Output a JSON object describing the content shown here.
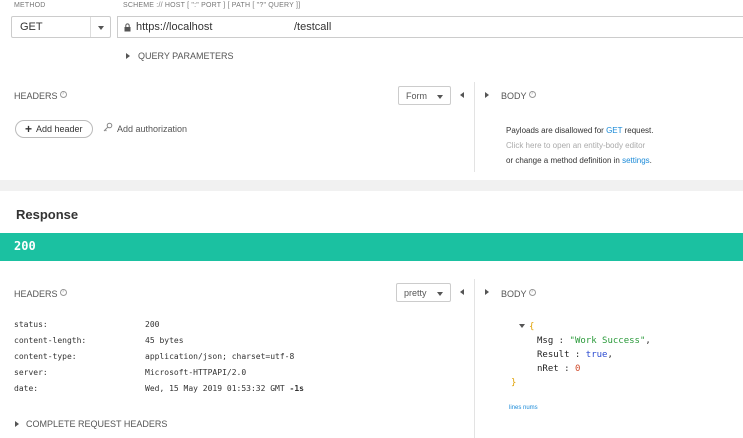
{
  "request": {
    "method_label": "METHOD",
    "scheme_label": "SCHEME :// HOST [ \":\" PORT ] [ PATH [ \"?\" QUERY ]]",
    "method_value": "GET",
    "url_prefix": "https://localhost",
    "url_path": "/testcall",
    "query_params_label": "QUERY PARAMETERS",
    "headers_title": "HEADERS",
    "form_label": "Form",
    "body_title": "BODY",
    "add_header_label": "Add header",
    "add_auth_label": "Add authorization",
    "body_msg_line1_a": "Payloads are disallowed for ",
    "body_msg_line1_link": "GET",
    "body_msg_line1_b": " request.",
    "body_msg_line2": "Click here to open an entity-body editor",
    "body_msg_line3_a": "or change a method definition in ",
    "body_msg_line3_link": "settings",
    "body_msg_line3_b": "."
  },
  "response": {
    "title": "Response",
    "status_code": "200",
    "status_color": "#1bc1a1",
    "headers_title": "HEADERS",
    "pretty_label": "pretty",
    "body_title": "BODY",
    "headers": [
      {
        "key": "status:",
        "value": "200"
      },
      {
        "key": "content-length:",
        "value": "45 bytes"
      },
      {
        "key": "content-type:",
        "value": "application/json; charset=utf-8"
      },
      {
        "key": "server:",
        "value": "Microsoft-HTTPAPI/2.0"
      },
      {
        "key": "date:",
        "value": "Wed, 15 May 2019 01:53:32 GMT",
        "suffix": "-1s"
      }
    ],
    "complete_headers_label": "COMPLETE REQUEST HEADERS",
    "json": {
      "open": "{",
      "close": "}",
      "lines": [
        {
          "key": "Msg",
          "sep": " : ",
          "value": "\"Work Success\"",
          "trail": ",",
          "value_color": "#2a9a3a"
        },
        {
          "key": "Result",
          "sep": " : ",
          "value": "true",
          "trail": ",",
          "value_color": "#2a4ad0"
        },
        {
          "key": "nRet",
          "sep": " : ",
          "value": "0",
          "trail": "",
          "value_color": "#d04a2a"
        }
      ]
    },
    "lines_nums_label": "lines nums"
  },
  "colors": {
    "accent": "#1a8ad8",
    "teal": "#1bc1a1"
  }
}
